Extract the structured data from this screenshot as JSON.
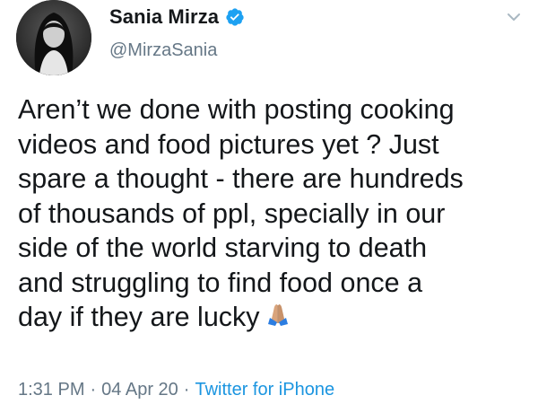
{
  "author": {
    "display_name": "Sania Mirza",
    "handle": "@MirzaSania",
    "verified": true,
    "avatar_icon": "profile-photo"
  },
  "tweet": {
    "text": "Aren’t we done with posting cooking\nvideos and food pictures yet ? Just\nspare a thought - there are hundreds\nof thousands of ppl, specially in our\nside of the world starving to death\nand struggling to find food once a\nday if they are lucky",
    "emoji_icon": "folded-hands-icon"
  },
  "meta": {
    "time": "1:31 PM",
    "separator": "·",
    "date": "04 Apr 20",
    "source": "Twitter for iPhone"
  },
  "colors": {
    "text": "#14171a",
    "secondary": "#657786",
    "link": "#1b95e0",
    "verified": "#1da1f2"
  },
  "icons": {
    "menu": "chevron-down-icon",
    "badge": "verified-badge-icon"
  }
}
